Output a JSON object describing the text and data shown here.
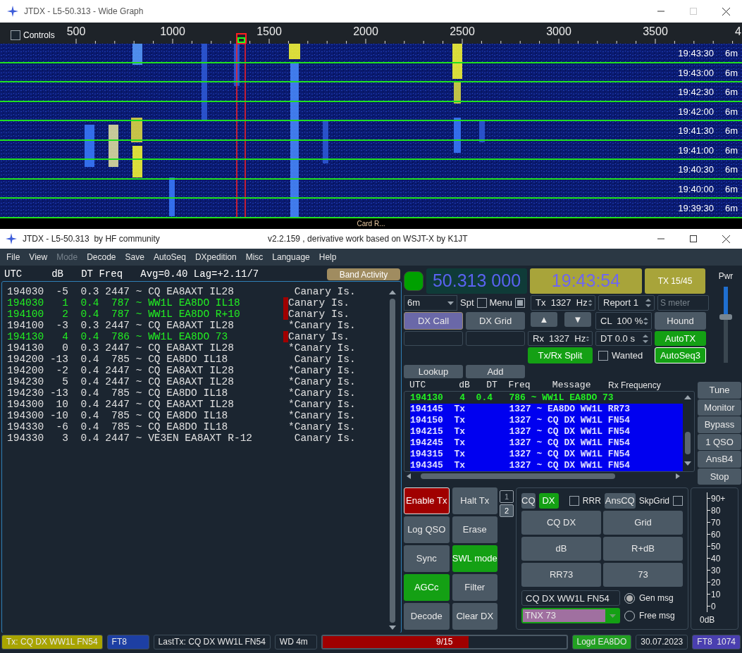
{
  "wide_graph": {
    "title": "JTDX - L5-50.313 - Wide Graph",
    "controls": {
      "label": "Controls",
      "checked": false
    },
    "freq_labels": [
      "500",
      "1000",
      "1500",
      "2000",
      "2500",
      "3000",
      "3500",
      "4"
    ],
    "rows": [
      {
        "time": "19:43:30",
        "band": "6m"
      },
      {
        "time": "19:43:00",
        "band": "6m"
      },
      {
        "time": "19:42:30",
        "band": "6m"
      },
      {
        "time": "19:42:00",
        "band": "6m"
      },
      {
        "time": "19:41:30",
        "band": "6m"
      },
      {
        "time": "19:41:00",
        "band": "6m"
      },
      {
        "time": "19:40:30",
        "band": "6m"
      },
      {
        "time": "19:40:00",
        "band": "6m"
      },
      {
        "time": "19:39:30",
        "band": "6m"
      }
    ],
    "footer": "Card R..."
  },
  "main_window": {
    "title": "JTDX - L5-50.313  by HF community",
    "version": "v2.2.159 , derivative work based on WSJT-X by K1JT"
  },
  "menu": [
    {
      "label": "File",
      "disabled": false
    },
    {
      "label": "View",
      "disabled": false
    },
    {
      "label": "Mode",
      "disabled": true
    },
    {
      "label": "Decode",
      "disabled": false
    },
    {
      "label": "Save",
      "disabled": false
    },
    {
      "label": "AutoSeq",
      "disabled": false
    },
    {
      "label": "DXpedition",
      "disabled": false
    },
    {
      "label": "Misc",
      "disabled": false
    },
    {
      "label": "Language",
      "disabled": false
    },
    {
      "label": "Help",
      "disabled": false
    }
  ],
  "band_activity": {
    "header": "UTC     dB   DT Freq   Avg=0.40 Lag=+2.11/7",
    "button": "Band Activity",
    "rows": [
      {
        "text": "194030  -5  0.3 2447 ~ CQ EA8AXT IL28",
        "country": " Canary Is.",
        "mine": false,
        "flag": false
      },
      {
        "text": "194030   1  0.4  787 ~ WW1L EA8DO IL18",
        "country": "Canary Is.",
        "mine": true,
        "flag": true
      },
      {
        "text": "194100   2  0.4  787 ~ WW1L EA8DO R+10",
        "country": "Canary Is.",
        "mine": true,
        "flag": true
      },
      {
        "text": "194100  -3  0.3 2447 ~ CQ EA8AXT IL28",
        "country": "*Canary Is.",
        "mine": false,
        "flag": false
      },
      {
        "text": "194130   4  0.4  786 ~ WW1L EA8DO 73",
        "country": "Canary Is.",
        "mine": true,
        "flag": true
      },
      {
        "text": "194130   0  0.3 2447 ~ CQ EA8AXT IL28",
        "country": "*Canary Is.",
        "mine": false,
        "flag": false
      },
      {
        "text": "194200 -13  0.4  785 ~ CQ EA8DO IL18",
        "country": " Canary Is.",
        "mine": false,
        "flag": false
      },
      {
        "text": "194200  -2  0.4 2447 ~ CQ EA8AXT IL28",
        "country": "*Canary Is.",
        "mine": false,
        "flag": false
      },
      {
        "text": "194230   5  0.4 2447 ~ CQ EA8AXT IL28",
        "country": "*Canary Is.",
        "mine": false,
        "flag": false
      },
      {
        "text": "194230 -13  0.4  785 ~ CQ EA8DO IL18",
        "country": "*Canary Is.",
        "mine": false,
        "flag": false
      },
      {
        "text": "194300  10  0.4 2447 ~ CQ EA8AXT IL28",
        "country": "*Canary Is.",
        "mine": false,
        "flag": false
      },
      {
        "text": "194300 -10  0.4  785 ~ CQ EA8DO IL18",
        "country": "*Canary Is.",
        "mine": false,
        "flag": false
      },
      {
        "text": "194330  -6  0.4  785 ~ CQ EA8DO IL18",
        "country": "*Canary Is.",
        "mine": false,
        "flag": false
      },
      {
        "text": "194330   3  0.4 2447 ~ VE3EN EA8AXT R-12",
        "country": " Canary Is.",
        "mine": false,
        "flag": false
      }
    ]
  },
  "controls": {
    "dial": "50.313 000",
    "clock": "19:43:54",
    "tx_period": "TX 15/45",
    "pwr_label": "Pwr",
    "pwr": {
      "level": 0.6
    },
    "band": "6m",
    "spt": {
      "label": "Spt",
      "checked": false
    },
    "menu": {
      "label": "Menu",
      "checked": true
    },
    "tx_freq": "Tx  1327  Hz",
    "report": "Report 1",
    "s_meter": {
      "placeholder": "S meter"
    },
    "dx_call": {
      "label": "DX Call",
      "highlighted": true
    },
    "dx_grid": {
      "label": "DX Grid",
      "highlighted": false
    },
    "up": "▲",
    "down": "▼",
    "cl": "CL  100 %",
    "hound": {
      "label": "Hound",
      "on": false
    },
    "rx_freq": "Rx  1327  Hz",
    "dt": "DT 0.0 s",
    "autotx": {
      "label": "AutoTX",
      "on": true
    },
    "split": {
      "label": "Tx/Rx Split",
      "on": true
    },
    "wanted": {
      "label": "Wanted",
      "checked": false
    },
    "autoseq": {
      "label": "AutoSeq3",
      "on": true
    },
    "lookup": "Lookup",
    "add": "Add"
  },
  "rx_panel": {
    "columns": "UTC      dB   DT  Freq    Message",
    "title": "Rx Frequency",
    "rows": [
      {
        "text": "194130   4  0.4   786 ~ WW1L EA8DO 73",
        "kind": "rx"
      },
      {
        "text": "194145  Tx        1327 ~ EA8DO WW1L RR73",
        "kind": "tx"
      },
      {
        "text": "194150  Tx        1327 ~ CQ DX WW1L FN54",
        "kind": "tx"
      },
      {
        "text": "194215  Tx        1327 ~ CQ DX WW1L FN54",
        "kind": "tx"
      },
      {
        "text": "194245  Tx        1327 ~ CQ DX WW1L FN54",
        "kind": "tx"
      },
      {
        "text": "194315  Tx        1327 ~ CQ DX WW1L FN54",
        "kind": "tx"
      },
      {
        "text": "194345  Tx        1327 ~ CQ DX WW1L FN54",
        "kind": "tx"
      }
    ]
  },
  "side_buttons": [
    "Tune",
    "Monitor",
    "Bypass",
    "1 QSO",
    "AnsB4",
    "Stop"
  ],
  "action_buttons": [
    {
      "label": "Enable Tx",
      "on": true,
      "kind": "tx"
    },
    {
      "label": "Halt Tx",
      "on": false,
      "kind": "toggle"
    },
    {
      "label": "Log QSO",
      "on": false,
      "kind": "toggle"
    },
    {
      "label": "Erase",
      "on": false,
      "kind": "toggle"
    },
    {
      "label": "Sync",
      "on": false,
      "kind": "toggle"
    },
    {
      "label": "SWL mode",
      "on": true,
      "kind": "toggle"
    },
    {
      "label": "AGCc",
      "on": true,
      "kind": "toggle"
    },
    {
      "label": "Filter",
      "on": false,
      "kind": "toggle"
    },
    {
      "label": "Decode",
      "on": false,
      "kind": "toggle"
    },
    {
      "label": "Clear DX",
      "on": false,
      "kind": "toggle"
    }
  ],
  "tabs": [
    {
      "label": "1",
      "selected": false
    },
    {
      "label": "2",
      "selected": true
    }
  ],
  "messages": {
    "cq": {
      "label": "CQ",
      "on": false
    },
    "dx": {
      "label": "DX",
      "on": true
    },
    "rrr": {
      "label": "RRR",
      "checked": false
    },
    "anscq": "AnsCQ",
    "skpgrid": {
      "label": "SkpGrid",
      "checked": false
    },
    "buttons": [
      "CQ DX",
      "Grid",
      "dB",
      "R+dB",
      "RR73",
      "73"
    ],
    "message": "CQ DX WW1L FN54",
    "gen": {
      "label": "Gen msg",
      "selected": true
    },
    "free_text": "TNX 73",
    "free": {
      "label": "Free msg",
      "selected": false
    }
  },
  "meter": {
    "scale": [
      "90+",
      "80",
      "70",
      "60",
      "50",
      "40",
      "30",
      "20",
      "10",
      "0"
    ],
    "reading": "0dB"
  },
  "status_bar": [
    {
      "kind": "label",
      "text": "Tx: CQ DX WW1L FN54",
      "color": "#a8a400"
    },
    {
      "kind": "label",
      "text": "FT8",
      "color": "#1d3fa3"
    },
    {
      "kind": "label",
      "text": "LastTx: CQ DX WW1L FN54",
      "color": "#1b2530"
    },
    {
      "kind": "label",
      "text": "WD 4m",
      "color": "#1b2530"
    },
    {
      "kind": "progress",
      "text": "9/15",
      "level": 0.6
    },
    {
      "kind": "label",
      "text": "Logd EA8DO",
      "color": "#22a022"
    },
    {
      "kind": "label",
      "text": "30.07.2023",
      "color": "#1b2530"
    },
    {
      "kind": "label",
      "text": "FT8  1074",
      "color": "#4a3fb0"
    }
  ]
}
